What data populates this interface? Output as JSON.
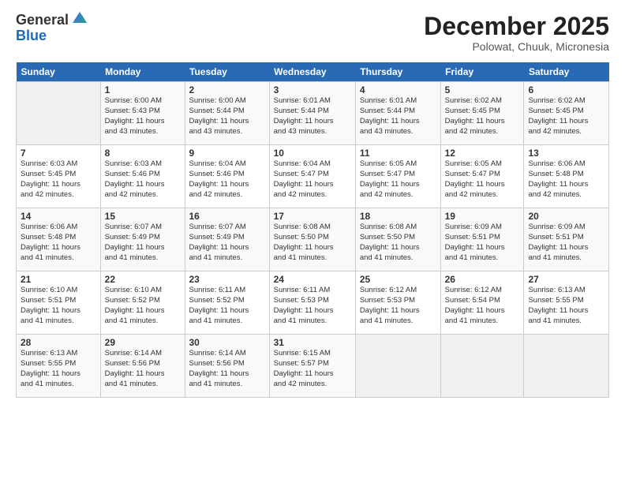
{
  "logo": {
    "general": "General",
    "blue": "Blue"
  },
  "title": "December 2025",
  "subtitle": "Polowat, Chuuk, Micronesia",
  "days_of_week": [
    "Sunday",
    "Monday",
    "Tuesday",
    "Wednesday",
    "Thursday",
    "Friday",
    "Saturday"
  ],
  "weeks": [
    [
      {
        "day": "",
        "sunrise": "",
        "sunset": "",
        "daylight": ""
      },
      {
        "day": "1",
        "sunrise": "Sunrise: 6:00 AM",
        "sunset": "Sunset: 5:43 PM",
        "daylight": "Daylight: 11 hours and 43 minutes."
      },
      {
        "day": "2",
        "sunrise": "Sunrise: 6:00 AM",
        "sunset": "Sunset: 5:44 PM",
        "daylight": "Daylight: 11 hours and 43 minutes."
      },
      {
        "day": "3",
        "sunrise": "Sunrise: 6:01 AM",
        "sunset": "Sunset: 5:44 PM",
        "daylight": "Daylight: 11 hours and 43 minutes."
      },
      {
        "day": "4",
        "sunrise": "Sunrise: 6:01 AM",
        "sunset": "Sunset: 5:44 PM",
        "daylight": "Daylight: 11 hours and 43 minutes."
      },
      {
        "day": "5",
        "sunrise": "Sunrise: 6:02 AM",
        "sunset": "Sunset: 5:45 PM",
        "daylight": "Daylight: 11 hours and 42 minutes."
      },
      {
        "day": "6",
        "sunrise": "Sunrise: 6:02 AM",
        "sunset": "Sunset: 5:45 PM",
        "daylight": "Daylight: 11 hours and 42 minutes."
      }
    ],
    [
      {
        "day": "7",
        "sunrise": "Sunrise: 6:03 AM",
        "sunset": "Sunset: 5:45 PM",
        "daylight": "Daylight: 11 hours and 42 minutes."
      },
      {
        "day": "8",
        "sunrise": "Sunrise: 6:03 AM",
        "sunset": "Sunset: 5:46 PM",
        "daylight": "Daylight: 11 hours and 42 minutes."
      },
      {
        "day": "9",
        "sunrise": "Sunrise: 6:04 AM",
        "sunset": "Sunset: 5:46 PM",
        "daylight": "Daylight: 11 hours and 42 minutes."
      },
      {
        "day": "10",
        "sunrise": "Sunrise: 6:04 AM",
        "sunset": "Sunset: 5:47 PM",
        "daylight": "Daylight: 11 hours and 42 minutes."
      },
      {
        "day": "11",
        "sunrise": "Sunrise: 6:05 AM",
        "sunset": "Sunset: 5:47 PM",
        "daylight": "Daylight: 11 hours and 42 minutes."
      },
      {
        "day": "12",
        "sunrise": "Sunrise: 6:05 AM",
        "sunset": "Sunset: 5:47 PM",
        "daylight": "Daylight: 11 hours and 42 minutes."
      },
      {
        "day": "13",
        "sunrise": "Sunrise: 6:06 AM",
        "sunset": "Sunset: 5:48 PM",
        "daylight": "Daylight: 11 hours and 42 minutes."
      }
    ],
    [
      {
        "day": "14",
        "sunrise": "Sunrise: 6:06 AM",
        "sunset": "Sunset: 5:48 PM",
        "daylight": "Daylight: 11 hours and 41 minutes."
      },
      {
        "day": "15",
        "sunrise": "Sunrise: 6:07 AM",
        "sunset": "Sunset: 5:49 PM",
        "daylight": "Daylight: 11 hours and 41 minutes."
      },
      {
        "day": "16",
        "sunrise": "Sunrise: 6:07 AM",
        "sunset": "Sunset: 5:49 PM",
        "daylight": "Daylight: 11 hours and 41 minutes."
      },
      {
        "day": "17",
        "sunrise": "Sunrise: 6:08 AM",
        "sunset": "Sunset: 5:50 PM",
        "daylight": "Daylight: 11 hours and 41 minutes."
      },
      {
        "day": "18",
        "sunrise": "Sunrise: 6:08 AM",
        "sunset": "Sunset: 5:50 PM",
        "daylight": "Daylight: 11 hours and 41 minutes."
      },
      {
        "day": "19",
        "sunrise": "Sunrise: 6:09 AM",
        "sunset": "Sunset: 5:51 PM",
        "daylight": "Daylight: 11 hours and 41 minutes."
      },
      {
        "day": "20",
        "sunrise": "Sunrise: 6:09 AM",
        "sunset": "Sunset: 5:51 PM",
        "daylight": "Daylight: 11 hours and 41 minutes."
      }
    ],
    [
      {
        "day": "21",
        "sunrise": "Sunrise: 6:10 AM",
        "sunset": "Sunset: 5:51 PM",
        "daylight": "Daylight: 11 hours and 41 minutes."
      },
      {
        "day": "22",
        "sunrise": "Sunrise: 6:10 AM",
        "sunset": "Sunset: 5:52 PM",
        "daylight": "Daylight: 11 hours and 41 minutes."
      },
      {
        "day": "23",
        "sunrise": "Sunrise: 6:11 AM",
        "sunset": "Sunset: 5:52 PM",
        "daylight": "Daylight: 11 hours and 41 minutes."
      },
      {
        "day": "24",
        "sunrise": "Sunrise: 6:11 AM",
        "sunset": "Sunset: 5:53 PM",
        "daylight": "Daylight: 11 hours and 41 minutes."
      },
      {
        "day": "25",
        "sunrise": "Sunrise: 6:12 AM",
        "sunset": "Sunset: 5:53 PM",
        "daylight": "Daylight: 11 hours and 41 minutes."
      },
      {
        "day": "26",
        "sunrise": "Sunrise: 6:12 AM",
        "sunset": "Sunset: 5:54 PM",
        "daylight": "Daylight: 11 hours and 41 minutes."
      },
      {
        "day": "27",
        "sunrise": "Sunrise: 6:13 AM",
        "sunset": "Sunset: 5:55 PM",
        "daylight": "Daylight: 11 hours and 41 minutes."
      }
    ],
    [
      {
        "day": "28",
        "sunrise": "Sunrise: 6:13 AM",
        "sunset": "Sunset: 5:55 PM",
        "daylight": "Daylight: 11 hours and 41 minutes."
      },
      {
        "day": "29",
        "sunrise": "Sunrise: 6:14 AM",
        "sunset": "Sunset: 5:56 PM",
        "daylight": "Daylight: 11 hours and 41 minutes."
      },
      {
        "day": "30",
        "sunrise": "Sunrise: 6:14 AM",
        "sunset": "Sunset: 5:56 PM",
        "daylight": "Daylight: 11 hours and 41 minutes."
      },
      {
        "day": "31",
        "sunrise": "Sunrise: 6:15 AM",
        "sunset": "Sunset: 5:57 PM",
        "daylight": "Daylight: 11 hours and 42 minutes."
      },
      {
        "day": "",
        "sunrise": "",
        "sunset": "",
        "daylight": ""
      },
      {
        "day": "",
        "sunrise": "",
        "sunset": "",
        "daylight": ""
      },
      {
        "day": "",
        "sunrise": "",
        "sunset": "",
        "daylight": ""
      }
    ]
  ]
}
